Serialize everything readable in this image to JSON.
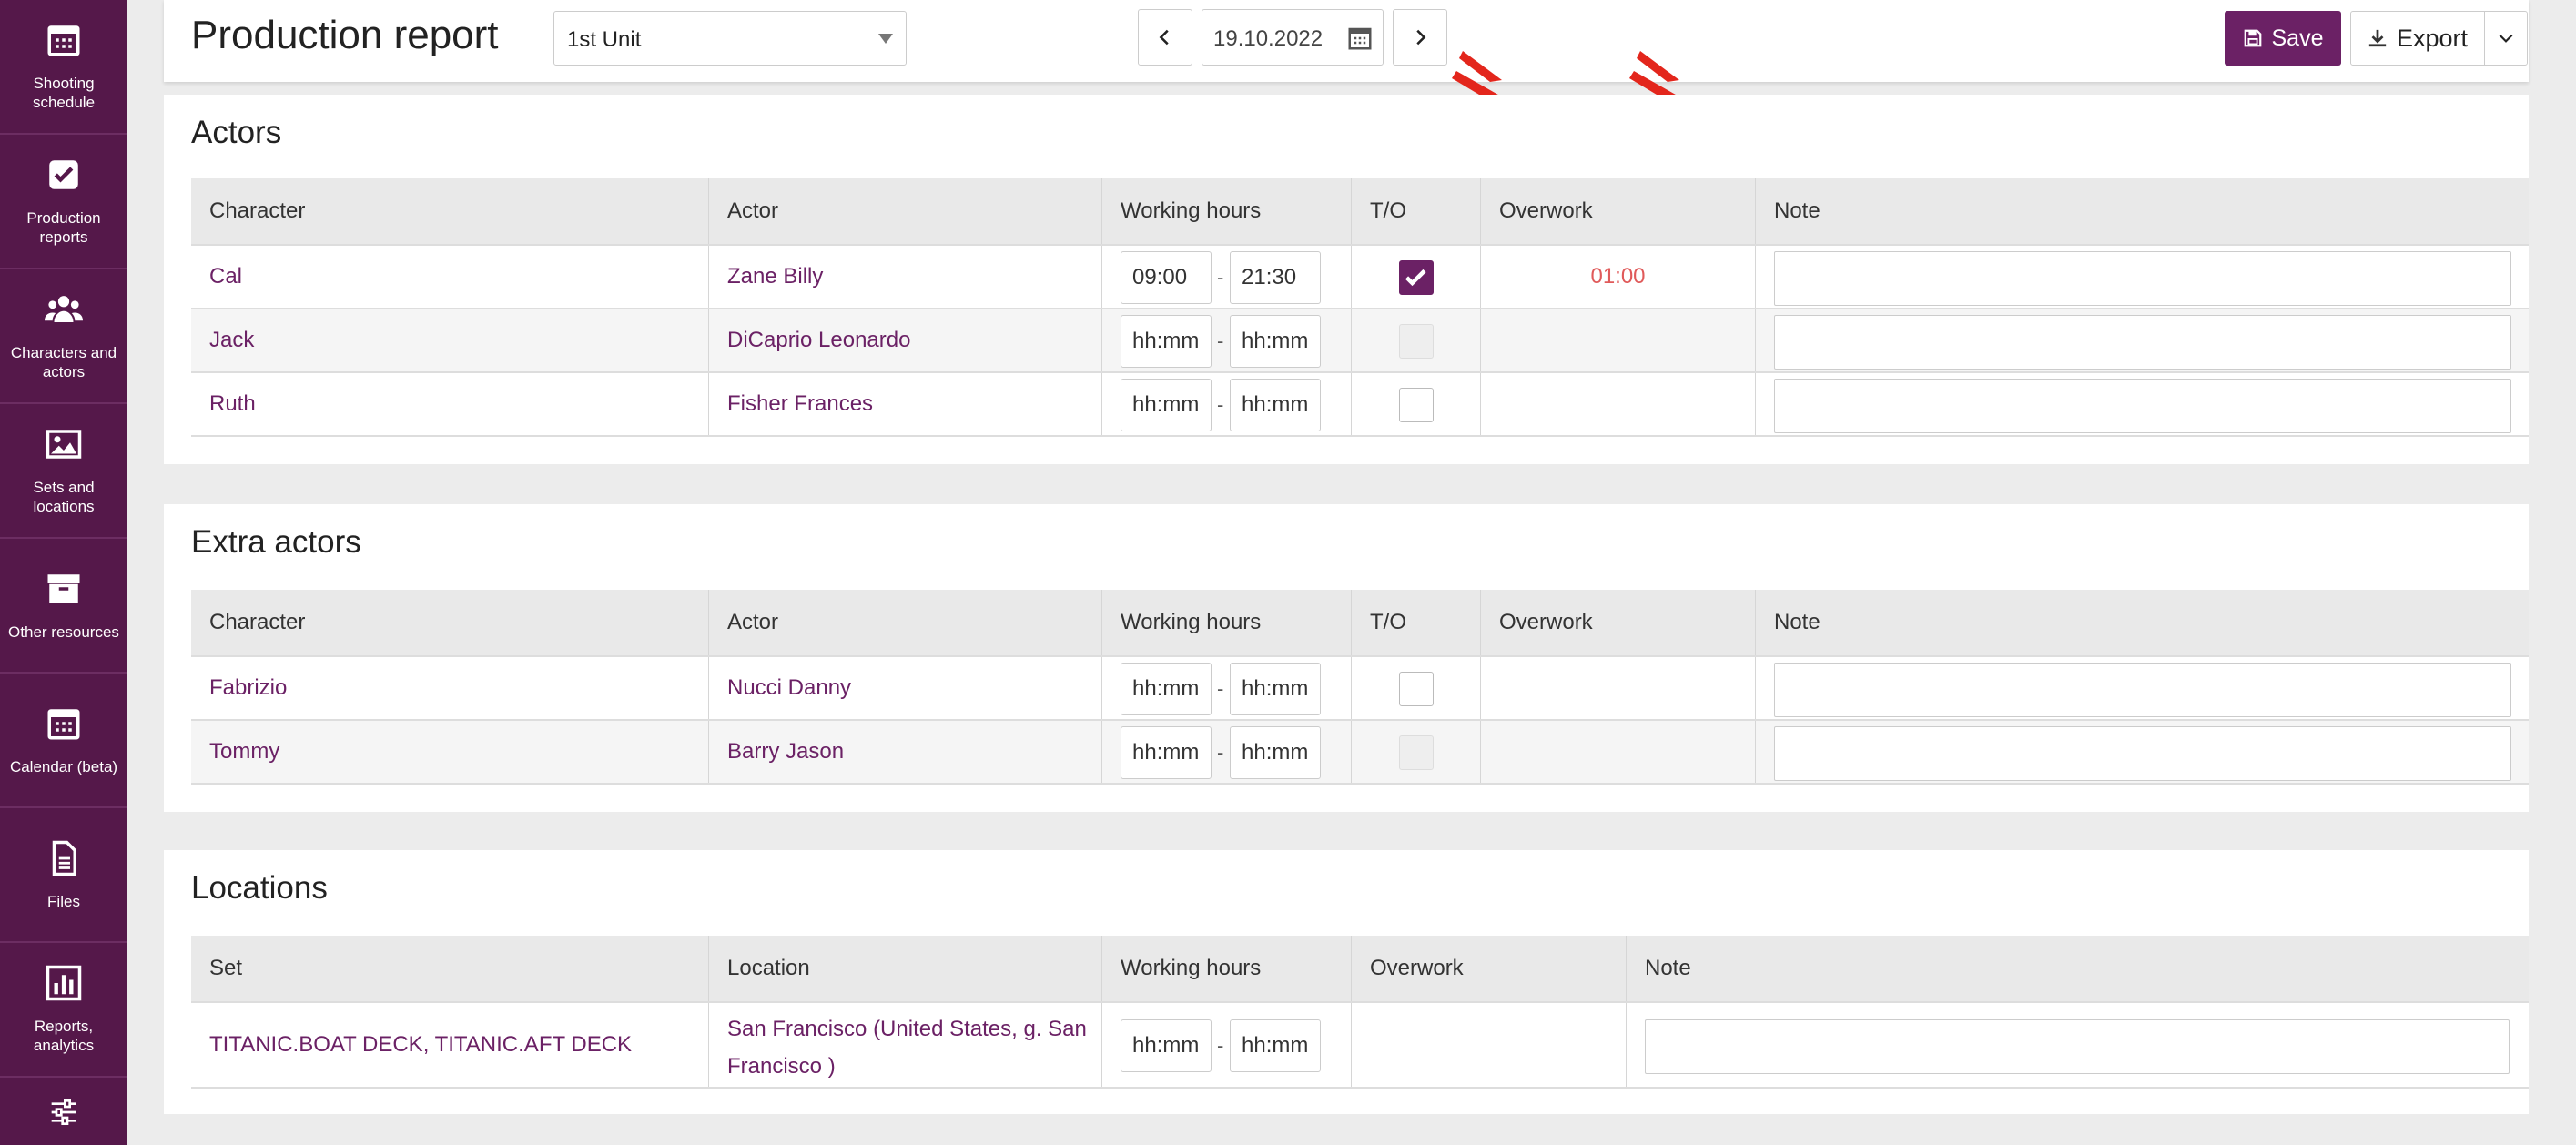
{
  "sidebar": {
    "items": [
      {
        "label": "Shooting schedule",
        "icon": "calendar-icon"
      },
      {
        "label": "Production reports",
        "icon": "check-square-icon"
      },
      {
        "label": "Characters and actors",
        "icon": "users-icon"
      },
      {
        "label": "Sets and locations",
        "icon": "image-icon"
      },
      {
        "label": "Other resources",
        "icon": "archive-icon"
      },
      {
        "label": "Calendar (beta)",
        "icon": "calendar-icon"
      },
      {
        "label": "Files",
        "icon": "file-icon"
      },
      {
        "label": "Reports, analytics",
        "icon": "bar-chart-icon"
      },
      {
        "label": "",
        "icon": "sliders-icon"
      }
    ]
  },
  "header": {
    "title": "Production report",
    "unit": "1st Unit",
    "date": "19.10.2022",
    "save_label": "Save",
    "export_label": "Export"
  },
  "colors": {
    "brand": "#55184a",
    "accent": "#6b2165",
    "overwork": "#e05a5a",
    "arrow": "#e3261c"
  },
  "actors": {
    "title": "Actors",
    "columns": [
      "Character",
      "Actor",
      "Working hours",
      "T/O",
      "Overwork",
      "Note"
    ],
    "rows": [
      {
        "character": "Cal",
        "actor": "Zane Billy",
        "start": "09:00",
        "end": "21:30",
        "to": "checked",
        "overwork": "01:00"
      },
      {
        "character": "Jack",
        "actor": "DiCaprio Leonardo",
        "start": "hh:mm",
        "end": "hh:mm",
        "to": "disabled",
        "overwork": ""
      },
      {
        "character": "Ruth",
        "actor": "Fisher Frances",
        "start": "hh:mm",
        "end": "hh:mm",
        "to": "unchecked",
        "overwork": ""
      }
    ]
  },
  "extras": {
    "title": "Extra actors",
    "columns": [
      "Character",
      "Actor",
      "Working hours",
      "T/O",
      "Overwork",
      "Note"
    ],
    "rows": [
      {
        "character": "Fabrizio",
        "actor": "Nucci Danny",
        "start": "hh:mm",
        "end": "hh:mm",
        "to": "unchecked"
      },
      {
        "character": "Tommy",
        "actor": "Barry Jason",
        "start": "hh:mm",
        "end": "hh:mm",
        "to": "disabled"
      }
    ]
  },
  "locations": {
    "title": "Locations",
    "columns": [
      "Set",
      "Location",
      "Working hours",
      "Overwork",
      "Note"
    ],
    "rows": [
      {
        "set": "TITANIC.BOAT DECK, TITANIC.AFT DECK",
        "location": "San Francisco (United States, g. San Francisco )",
        "start": "hh:mm",
        "end": "hh:mm"
      }
    ]
  },
  "time_separator": "-"
}
